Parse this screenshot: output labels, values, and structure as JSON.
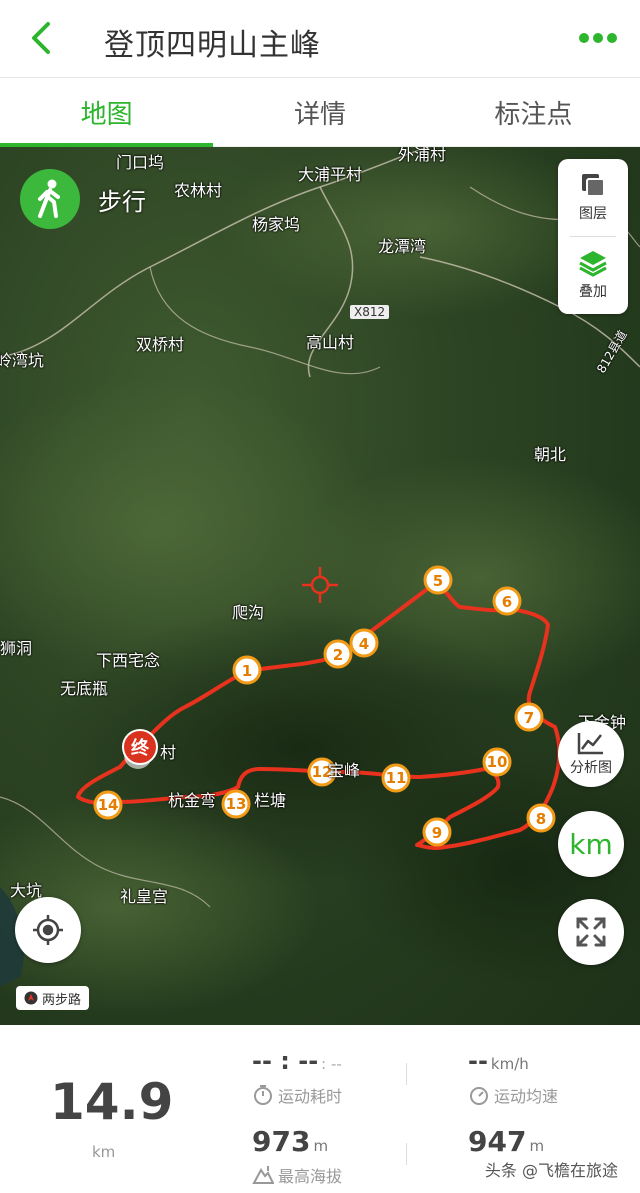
{
  "header": {
    "title": "登顶四明山主峰"
  },
  "tabs": [
    {
      "label": "地图",
      "active": true
    },
    {
      "label": "详情",
      "active": false
    },
    {
      "label": "标注点",
      "active": false
    }
  ],
  "map": {
    "mode_label": "步行",
    "layer_label": "图层",
    "overlay_label": "叠加",
    "analysis_label": "分析图",
    "km_label": "km",
    "end_marker": "终",
    "logo_label": "两步路",
    "places": {
      "menkouwu": "门口坞",
      "nonglincun": "农林村",
      "dapupingcun": "大浦平村",
      "waipucun": "外浦村",
      "yangjiawu": "杨家坞",
      "longtanwan": "龙潭湾",
      "road": "X812",
      "shuangqiaocun": "双桥村",
      "gaoshancun": "高山村",
      "lingwankeng": "岭湾坑",
      "county_road": "812县道",
      "chaobei": "朝北",
      "pagou": "爬沟",
      "shidong": "狮洞",
      "xiaxizhainian": "下西宅念",
      "wudiping": "无底瓶",
      "cun": "村",
      "xiajinzhong": "下金钟",
      "jinlong": "杭金弯",
      "lantang": "栏塘",
      "feng": "宝峰",
      "dakeng": "大坑",
      "lihuanggong": "礼皇宫"
    },
    "waypoints": [
      "1",
      "2",
      "4",
      "5",
      "6",
      "7",
      "8",
      "9",
      "10",
      "11",
      "12",
      "13",
      "14"
    ]
  },
  "stats": {
    "distance_value": "14.9",
    "distance_unit": "km",
    "time_value": "-- : --",
    "time_sub": ": --",
    "time_label": "运动耗时",
    "speed_value": "--",
    "speed_unit": "km/h",
    "speed_label": "运动均速",
    "max_alt_value": "973",
    "max_alt_unit": "m",
    "max_alt_label": "最高海拔",
    "min_alt_value": "947",
    "min_alt_unit": "m",
    "watermark": "头条 @飞檐在旅途"
  },
  "colors": {
    "accent": "#2db52d",
    "track": "#e8321e",
    "waypoint": "#f39a17"
  }
}
